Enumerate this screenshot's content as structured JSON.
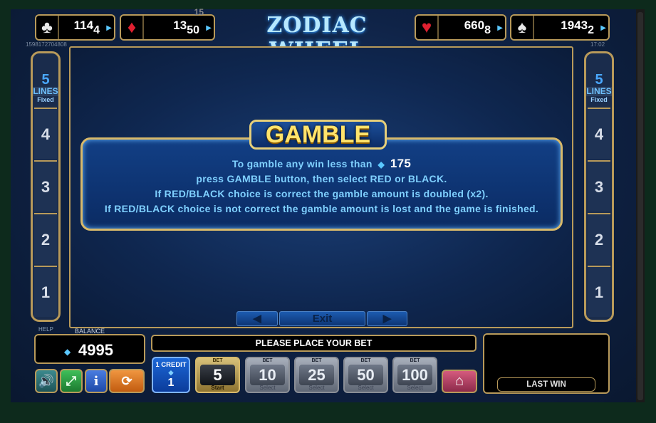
{
  "jackpots": [
    {
      "suit": "♣",
      "suit_name": "clubs",
      "value": "114",
      "sub": "4"
    },
    {
      "suit": "♦",
      "suit_name": "diamonds",
      "value": "13",
      "sub": "50",
      "super": "15"
    },
    {
      "suit": "♥",
      "suit_name": "hearts",
      "value": "660",
      "sub": "8"
    },
    {
      "suit": "♠",
      "suit_name": "spades",
      "value": "1943",
      "sub": "2"
    }
  ],
  "game_id": "1598172704808",
  "clock": "17:02",
  "logo": "ZODIAC WHEEL",
  "lines": {
    "count": "5",
    "label": "LINES",
    "mode": "Fixed",
    "numbers": [
      "4",
      "3",
      "2",
      "1"
    ]
  },
  "gamble": {
    "title": "GAMBLE",
    "line1": "To gamble any win less than",
    "limit": "175",
    "line2": "press GAMBLE button, then select RED or BLACK.",
    "line3": "If RED/BLACK choice is correct the gamble amount is doubled (x2).",
    "line4": "If RED/BLACK choice is not correct the gamble amount is lost and the game is finished."
  },
  "nav": {
    "prev": "◀",
    "exit": "Exit",
    "next": "▶"
  },
  "help_label": "HELP",
  "balance": {
    "label": "BALANCE",
    "value": "4995"
  },
  "status": "PLEASE PLACE YOUR BET",
  "credit": {
    "label": "1 CREDIT",
    "value": "1"
  },
  "bets": [
    {
      "top": "BET",
      "value": "5",
      "bottom": "Start",
      "active": true
    },
    {
      "top": "BET",
      "value": "10",
      "bottom": "Select"
    },
    {
      "top": "BET",
      "value": "25",
      "bottom": "Select"
    },
    {
      "top": "BET",
      "value": "50",
      "bottom": "Select"
    },
    {
      "top": "BET",
      "value": "100",
      "bottom": "Select"
    }
  ],
  "last_win": {
    "label": "LAST WIN"
  },
  "controls": {
    "sound_icon": "speaker-icon",
    "fullscreen_icon": "fullscreen-icon",
    "info_icon": "info-icon",
    "autoplay_icon": "autoplay-icon",
    "home_icon": "home-icon"
  },
  "colors": {
    "frame_gold": "#b89a5a",
    "title_yellow": "#ffe36b",
    "text_blue": "#7fd0ff",
    "credit_blue": "#1c67d6",
    "home_pink": "#d55b7e"
  }
}
